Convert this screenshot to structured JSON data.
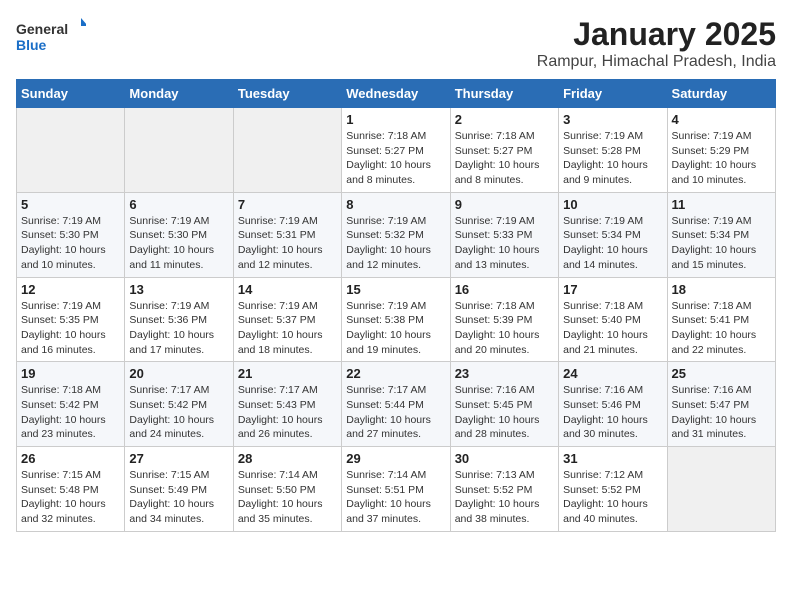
{
  "header": {
    "logo_general": "General",
    "logo_blue": "Blue",
    "title": "January 2025",
    "subtitle": "Rampur, Himachal Pradesh, India"
  },
  "weekdays": [
    "Sunday",
    "Monday",
    "Tuesday",
    "Wednesday",
    "Thursday",
    "Friday",
    "Saturday"
  ],
  "weeks": [
    [
      {
        "day": "",
        "info": ""
      },
      {
        "day": "",
        "info": ""
      },
      {
        "day": "",
        "info": ""
      },
      {
        "day": "1",
        "info": "Sunrise: 7:18 AM\nSunset: 5:27 PM\nDaylight: 10 hours and 8 minutes."
      },
      {
        "day": "2",
        "info": "Sunrise: 7:18 AM\nSunset: 5:27 PM\nDaylight: 10 hours and 8 minutes."
      },
      {
        "day": "3",
        "info": "Sunrise: 7:19 AM\nSunset: 5:28 PM\nDaylight: 10 hours and 9 minutes."
      },
      {
        "day": "4",
        "info": "Sunrise: 7:19 AM\nSunset: 5:29 PM\nDaylight: 10 hours and 10 minutes."
      }
    ],
    [
      {
        "day": "5",
        "info": "Sunrise: 7:19 AM\nSunset: 5:30 PM\nDaylight: 10 hours and 10 minutes."
      },
      {
        "day": "6",
        "info": "Sunrise: 7:19 AM\nSunset: 5:30 PM\nDaylight: 10 hours and 11 minutes."
      },
      {
        "day": "7",
        "info": "Sunrise: 7:19 AM\nSunset: 5:31 PM\nDaylight: 10 hours and 12 minutes."
      },
      {
        "day": "8",
        "info": "Sunrise: 7:19 AM\nSunset: 5:32 PM\nDaylight: 10 hours and 12 minutes."
      },
      {
        "day": "9",
        "info": "Sunrise: 7:19 AM\nSunset: 5:33 PM\nDaylight: 10 hours and 13 minutes."
      },
      {
        "day": "10",
        "info": "Sunrise: 7:19 AM\nSunset: 5:34 PM\nDaylight: 10 hours and 14 minutes."
      },
      {
        "day": "11",
        "info": "Sunrise: 7:19 AM\nSunset: 5:34 PM\nDaylight: 10 hours and 15 minutes."
      }
    ],
    [
      {
        "day": "12",
        "info": "Sunrise: 7:19 AM\nSunset: 5:35 PM\nDaylight: 10 hours and 16 minutes."
      },
      {
        "day": "13",
        "info": "Sunrise: 7:19 AM\nSunset: 5:36 PM\nDaylight: 10 hours and 17 minutes."
      },
      {
        "day": "14",
        "info": "Sunrise: 7:19 AM\nSunset: 5:37 PM\nDaylight: 10 hours and 18 minutes."
      },
      {
        "day": "15",
        "info": "Sunrise: 7:19 AM\nSunset: 5:38 PM\nDaylight: 10 hours and 19 minutes."
      },
      {
        "day": "16",
        "info": "Sunrise: 7:18 AM\nSunset: 5:39 PM\nDaylight: 10 hours and 20 minutes."
      },
      {
        "day": "17",
        "info": "Sunrise: 7:18 AM\nSunset: 5:40 PM\nDaylight: 10 hours and 21 minutes."
      },
      {
        "day": "18",
        "info": "Sunrise: 7:18 AM\nSunset: 5:41 PM\nDaylight: 10 hours and 22 minutes."
      }
    ],
    [
      {
        "day": "19",
        "info": "Sunrise: 7:18 AM\nSunset: 5:42 PM\nDaylight: 10 hours and 23 minutes."
      },
      {
        "day": "20",
        "info": "Sunrise: 7:17 AM\nSunset: 5:42 PM\nDaylight: 10 hours and 24 minutes."
      },
      {
        "day": "21",
        "info": "Sunrise: 7:17 AM\nSunset: 5:43 PM\nDaylight: 10 hours and 26 minutes."
      },
      {
        "day": "22",
        "info": "Sunrise: 7:17 AM\nSunset: 5:44 PM\nDaylight: 10 hours and 27 minutes."
      },
      {
        "day": "23",
        "info": "Sunrise: 7:16 AM\nSunset: 5:45 PM\nDaylight: 10 hours and 28 minutes."
      },
      {
        "day": "24",
        "info": "Sunrise: 7:16 AM\nSunset: 5:46 PM\nDaylight: 10 hours and 30 minutes."
      },
      {
        "day": "25",
        "info": "Sunrise: 7:16 AM\nSunset: 5:47 PM\nDaylight: 10 hours and 31 minutes."
      }
    ],
    [
      {
        "day": "26",
        "info": "Sunrise: 7:15 AM\nSunset: 5:48 PM\nDaylight: 10 hours and 32 minutes."
      },
      {
        "day": "27",
        "info": "Sunrise: 7:15 AM\nSunset: 5:49 PM\nDaylight: 10 hours and 34 minutes."
      },
      {
        "day": "28",
        "info": "Sunrise: 7:14 AM\nSunset: 5:50 PM\nDaylight: 10 hours and 35 minutes."
      },
      {
        "day": "29",
        "info": "Sunrise: 7:14 AM\nSunset: 5:51 PM\nDaylight: 10 hours and 37 minutes."
      },
      {
        "day": "30",
        "info": "Sunrise: 7:13 AM\nSunset: 5:52 PM\nDaylight: 10 hours and 38 minutes."
      },
      {
        "day": "31",
        "info": "Sunrise: 7:12 AM\nSunset: 5:52 PM\nDaylight: 10 hours and 40 minutes."
      },
      {
        "day": "",
        "info": ""
      }
    ]
  ]
}
